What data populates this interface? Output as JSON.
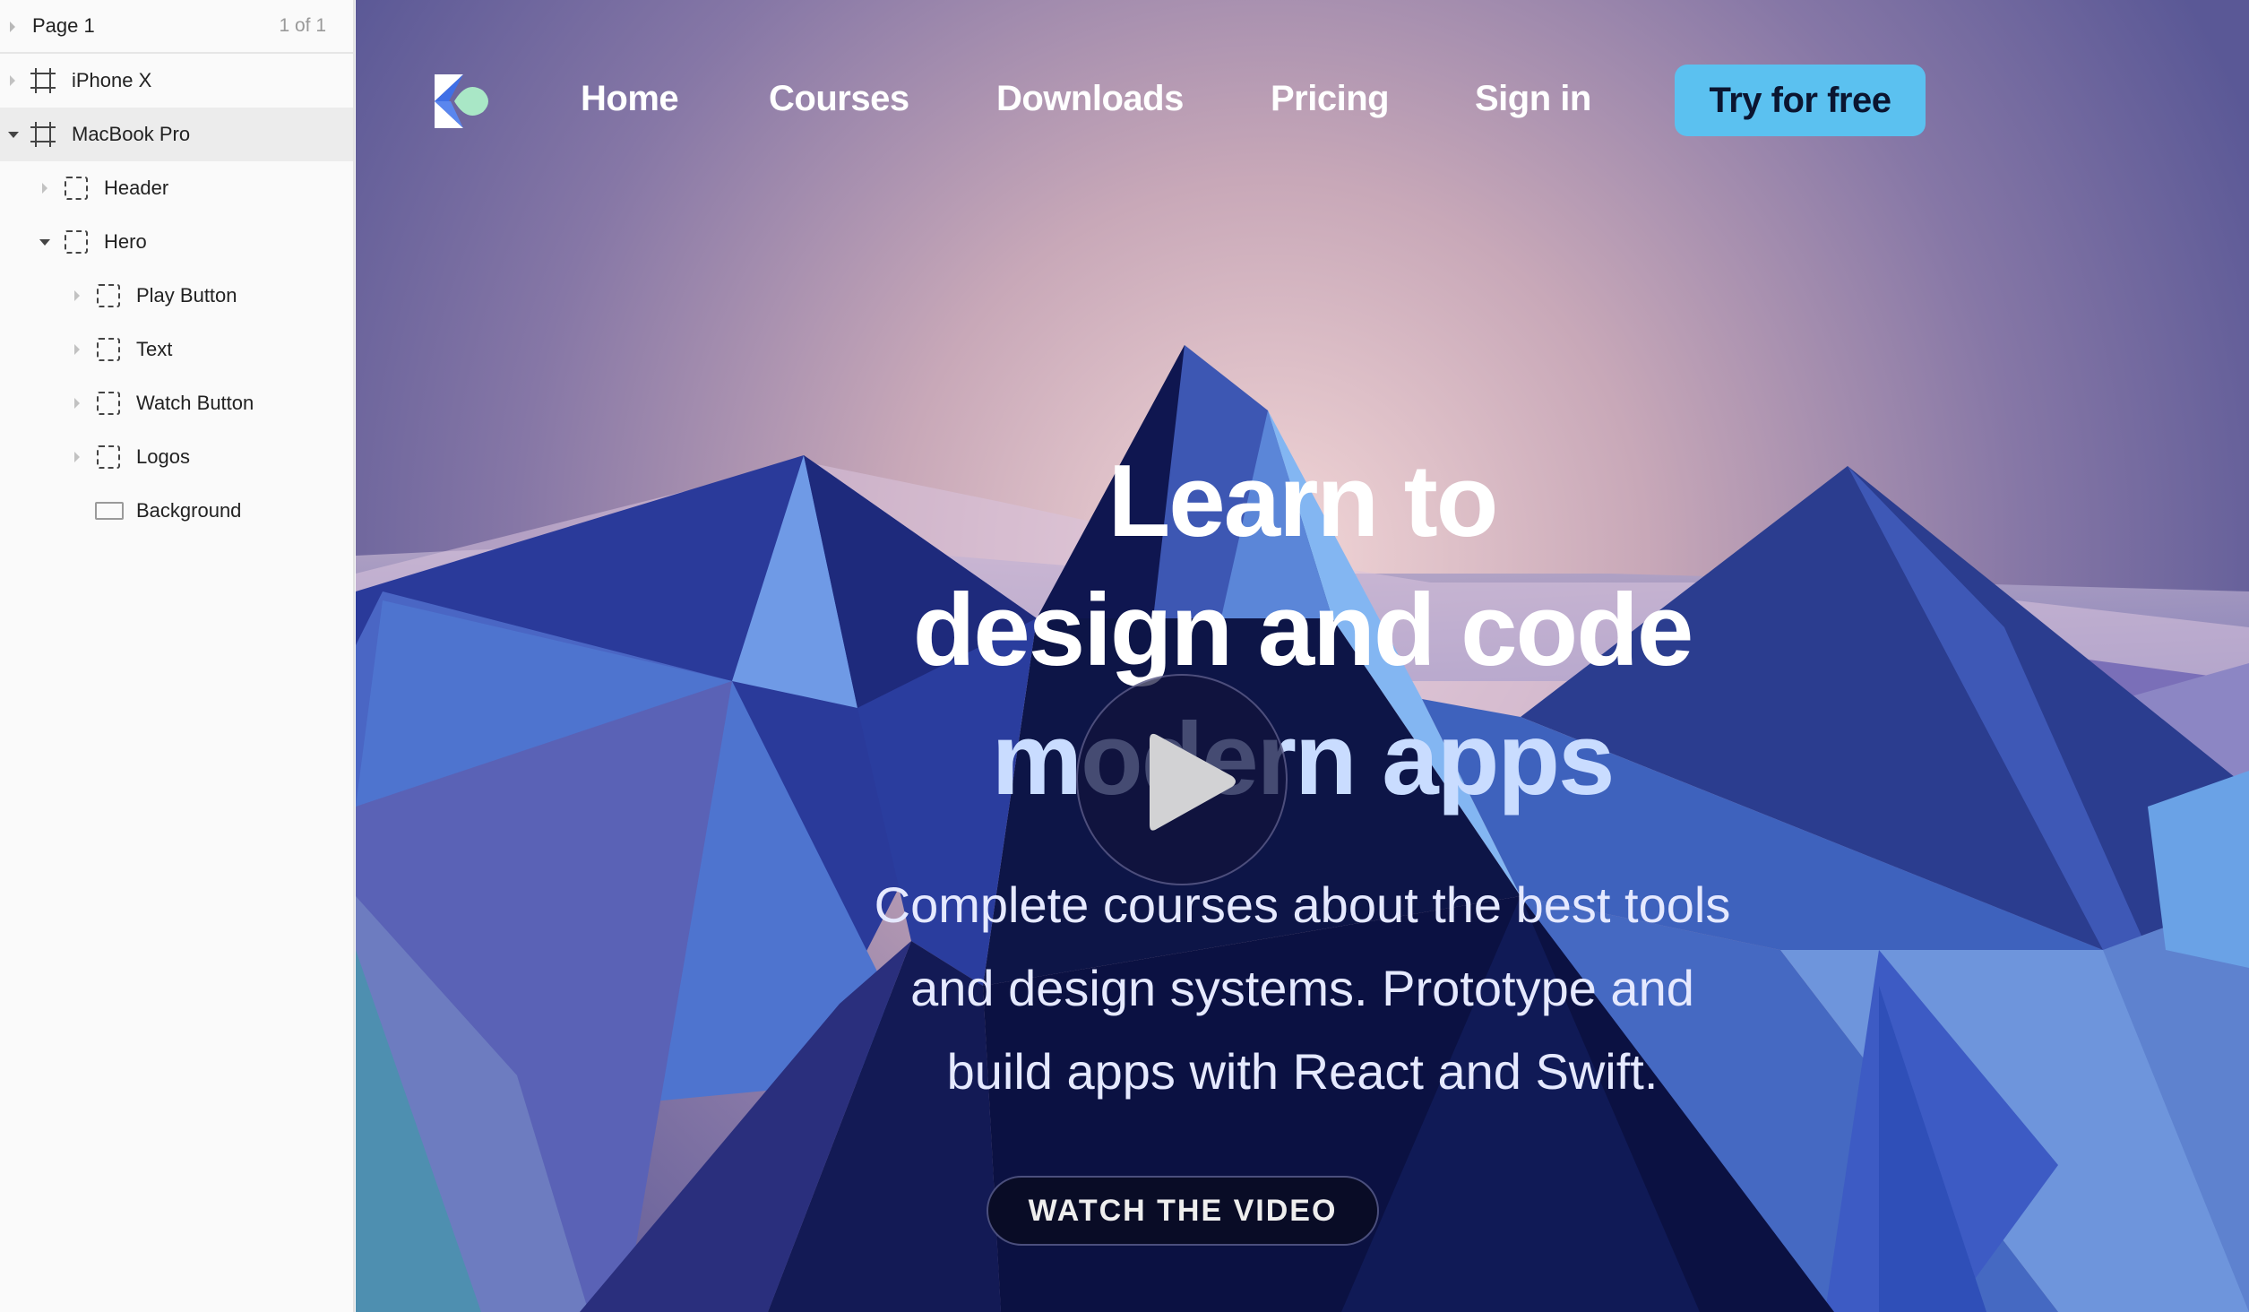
{
  "sidebar": {
    "page": {
      "label": "Page 1",
      "count": "1 of 1"
    },
    "layers": [
      {
        "label": "iPhone X"
      },
      {
        "label": "MacBook Pro"
      },
      {
        "label": "Header"
      },
      {
        "label": "Hero"
      },
      {
        "label": "Play Button"
      },
      {
        "label": "Text"
      },
      {
        "label": "Watch Button"
      },
      {
        "label": "Logos"
      },
      {
        "label": "Background"
      }
    ]
  },
  "nav": {
    "links": [
      "Home",
      "Courses",
      "Downloads",
      "Pricing",
      "Sign in"
    ],
    "cta": "Try for free"
  },
  "hero": {
    "headline": [
      "Learn to",
      "design and code",
      "modern apps"
    ],
    "subtitle": [
      "Complete courses about the best tools",
      "and design systems. Prototype and",
      "build apps with React and Swift."
    ],
    "watch_button": "WATCH THE VIDEO"
  },
  "colors": {
    "cta": "#5bc1f0",
    "watch_button": "#090c26",
    "sky_top": "#5b5a98",
    "sky_glow": "#efd0d4"
  },
  "icons": {
    "artboard": "artboard-icon",
    "group": "group-icon",
    "rectangle": "rectangle-icon",
    "logo": "logo-icon",
    "play": "play-icon"
  }
}
